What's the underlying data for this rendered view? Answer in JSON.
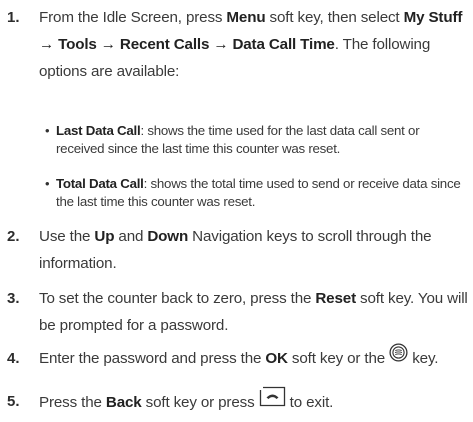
{
  "steps": [
    {
      "num": "1.",
      "parts": [
        {
          "t": "From the Idle Screen, press "
        },
        {
          "b": "Menu"
        },
        {
          "t": " soft key, then select "
        },
        {
          "b": "My Stuff → Tools → Recent Calls → Data Call Time"
        },
        {
          "t": ". The following options are available:"
        }
      ]
    },
    {
      "num": "2.",
      "parts": [
        {
          "t": "Use the "
        },
        {
          "b": "Up"
        },
        {
          "t": " and "
        },
        {
          "b": "Down"
        },
        {
          "t": " Navigation keys to scroll through the information."
        }
      ]
    },
    {
      "num": "3.",
      "parts": [
        {
          "t": "To set the counter back to zero, press the "
        },
        {
          "b": "Reset"
        },
        {
          "t": " soft key. You will be prompted for a password."
        }
      ]
    },
    {
      "num": "4.",
      "parts": [
        {
          "t": "Enter the password and press the "
        },
        {
          "b": "OK"
        },
        {
          "t": " soft key or the "
        },
        {
          "icon": "center-select-key-icon"
        },
        {
          "t": " key."
        }
      ]
    },
    {
      "num": "5.",
      "parts": [
        {
          "t": "Press the "
        },
        {
          "b": "Back"
        },
        {
          "t": " soft key or press "
        },
        {
          "icon": "end-call-key-icon"
        },
        {
          "t": " to exit."
        }
      ]
    }
  ],
  "bullets": [
    {
      "term": "Last Data Call",
      "desc": ": shows the time used for the last data call sent or received since the last time this counter was reset."
    },
    {
      "term": "Total Data Call",
      "desc": ": shows the total time used to send or receive data since the last time this counter was reset."
    }
  ],
  "bullet_glyph": "•"
}
